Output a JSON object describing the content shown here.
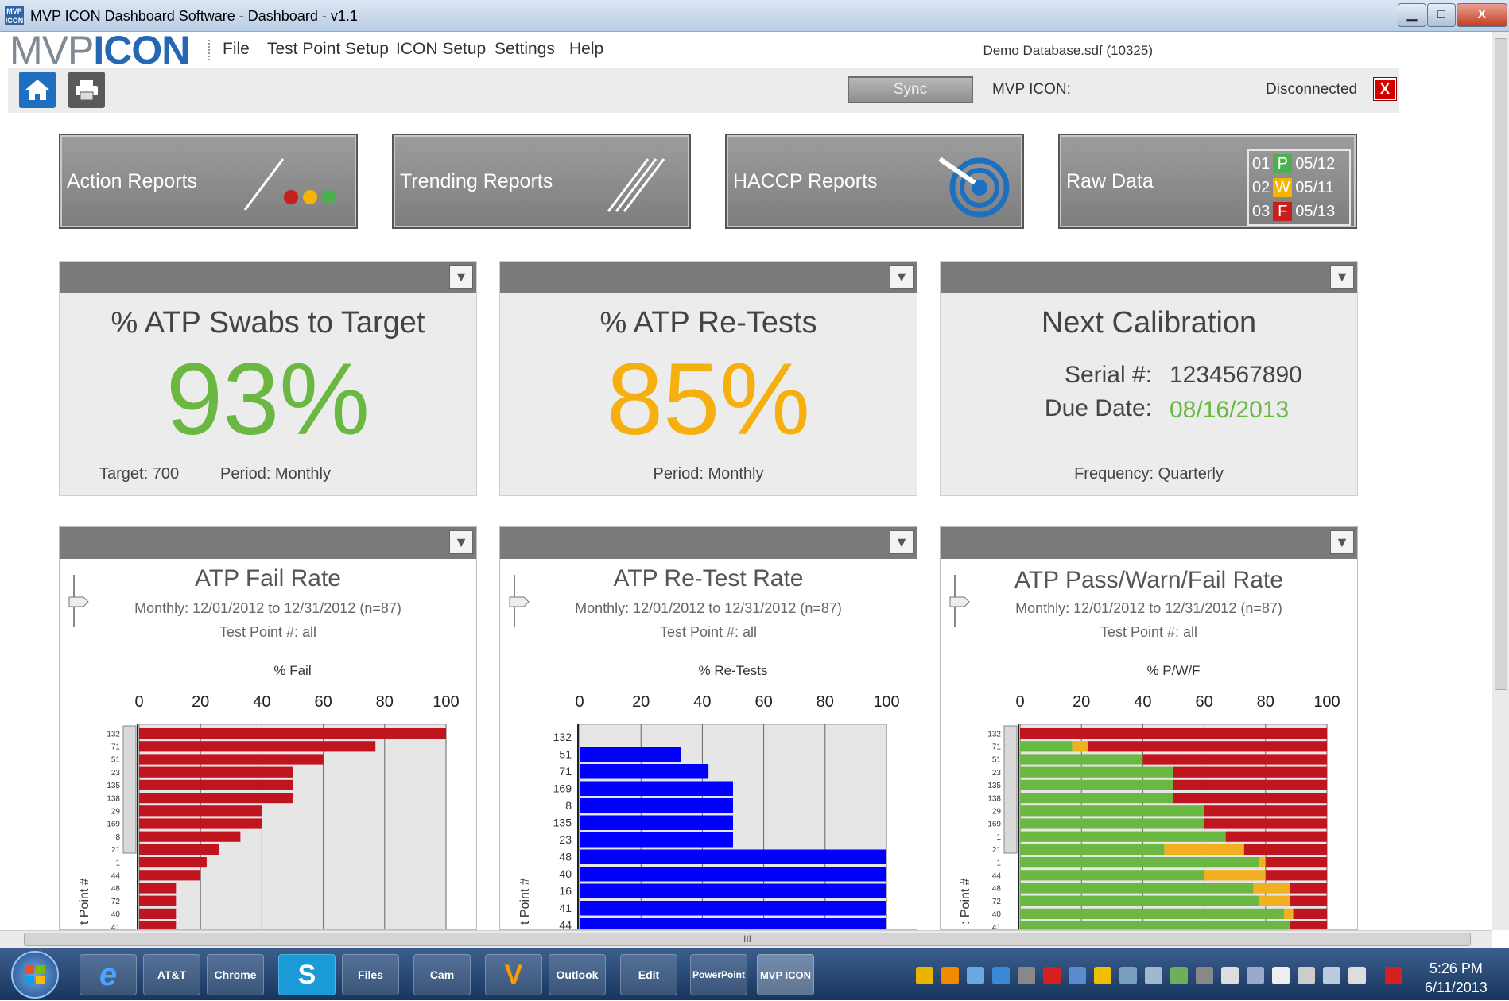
{
  "window": {
    "title": "MVP ICON Dashboard Software - Dashboard  - v1.1",
    "app_icon_text": "MVP ICON",
    "min": "▁",
    "max": "□",
    "close": "X"
  },
  "logo": {
    "part1": "MVP",
    "part2": "ICON"
  },
  "menu": [
    "File",
    "Test Point Setup",
    "ICON Setup",
    "Settings",
    "Help"
  ],
  "database": "Demo Database.sdf (10325)",
  "toolbar": {
    "sync_label": "Sync",
    "mvp_icon_label": "MVP ICON:",
    "status": "Disconnected",
    "close_glyph": "X"
  },
  "tiles": [
    {
      "label": "Action Reports"
    },
    {
      "label": "Trending Reports"
    },
    {
      "label": "HACCP Reports"
    },
    {
      "label": "Raw Data"
    }
  ],
  "raw_data_rows": [
    {
      "num": "01",
      "code": "P",
      "date": "05/12",
      "color": "#4caf50"
    },
    {
      "num": "02",
      "code": "W",
      "date": "05/11",
      "color": "#f5b400"
    },
    {
      "num": "03",
      "code": "F",
      "date": "05/13",
      "color": "#c81e1e"
    }
  ],
  "colors": {
    "green": "#6ab842",
    "orange": "#f5b010",
    "red": "#c0141e",
    "blue": "#0000ff",
    "warn": "#f0b020"
  },
  "widgets": {
    "atp_target": {
      "title": "% ATP Swabs to Target",
      "value": "93%",
      "target_label": "Target: 700",
      "period_label": "Period: Monthly"
    },
    "atp_retests": {
      "title": "% ATP Re-Tests",
      "value": "85%",
      "period_label": "Period:  Monthly"
    },
    "calibration": {
      "title": "Next Calibration",
      "serial_label": "Serial #:",
      "serial_value": "1234567890",
      "due_label": "Due Date:",
      "due_value": "08/16/2013",
      "frequency_label": "Frequency:  Quarterly"
    }
  },
  "charts": [
    {
      "title": "ATP Fail Rate",
      "subtitle": "Monthly: 12/01/2012 to 12/31/2012 (n=87)",
      "testpoint": "Test Point #: all",
      "axis_title": "% Fail",
      "ylabel": "t Point #"
    },
    {
      "title": "ATP Re-Test Rate",
      "subtitle": "Monthly: 12/01/2012 to 12/31/2012 (n=87)",
      "testpoint": "Test Point #: all",
      "axis_title": "% Re-Tests",
      "ylabel": "t Point #"
    },
    {
      "title": "ATP Pass/Warn/Fail Rate",
      "subtitle": "Monthly: 12/01/2012 to 12/31/2012 (n=87)",
      "testpoint": "Test Point #: all",
      "axis_title": "% P/W/F",
      "ylabel": ": Point #"
    }
  ],
  "chart_data": [
    {
      "type": "bar",
      "title": "ATP Fail Rate",
      "xlabel": "% Fail",
      "ylabel": "t Point #",
      "xlim": [
        0,
        100
      ],
      "ticks": [
        0,
        20,
        40,
        60,
        80,
        100
      ],
      "grid": true,
      "categories": [
        "132",
        "71",
        "51",
        "23",
        "135",
        "138",
        "29",
        "169",
        "8",
        "21",
        "1",
        "44",
        "48",
        "72",
        "40",
        "41"
      ],
      "values": [
        100,
        77,
        60,
        50,
        50,
        50,
        40,
        40,
        33,
        26,
        22,
        20,
        12,
        12,
        12,
        12
      ]
    },
    {
      "type": "bar",
      "title": "ATP Re-Test Rate",
      "xlabel": "% Re-Tests",
      "ylabel": "t Point #",
      "xlim": [
        0,
        100
      ],
      "ticks": [
        0,
        20,
        40,
        60,
        80,
        100
      ],
      "grid": true,
      "categories": [
        "132",
        "51",
        "71",
        "169",
        "8",
        "135",
        "23",
        "48",
        "40",
        "16",
        "41",
        "44"
      ],
      "values": [
        0,
        33,
        42,
        50,
        50,
        50,
        50,
        100,
        100,
        100,
        100,
        100
      ]
    },
    {
      "type": "bar",
      "stacked": true,
      "title": "ATP Pass/Warn/Fail Rate",
      "xlabel": "% P/W/F",
      "ylabel": ": Point #",
      "xlim": [
        0,
        100
      ],
      "ticks": [
        0,
        20,
        40,
        60,
        80,
        100
      ],
      "grid": true,
      "categories": [
        "132",
        "71",
        "51",
        "23",
        "135",
        "138",
        "29",
        "169",
        "1",
        "21",
        "1",
        "44",
        "48",
        "72",
        "40",
        "41"
      ],
      "series": [
        {
          "name": "Pass",
          "values": [
            0,
            17,
            40,
            50,
            50,
            50,
            60,
            60,
            67,
            47,
            78,
            60,
            76,
            78,
            86,
            88
          ]
        },
        {
          "name": "Warn",
          "values": [
            0,
            5,
            0,
            0,
            0,
            0,
            0,
            0,
            0,
            26,
            2,
            20,
            12,
            10,
            3,
            0
          ]
        },
        {
          "name": "Fail",
          "values": [
            100,
            78,
            60,
            50,
            50,
            50,
            40,
            40,
            33,
            27,
            20,
            20,
            12,
            12,
            11,
            12
          ]
        }
      ]
    }
  ],
  "scroll": {
    "h_grip": "III"
  },
  "taskbar": {
    "apps": [
      "e",
      "AT&T",
      "Chrome",
      "S",
      "Files",
      "Cam",
      "V",
      "Outlook",
      "Edit",
      "PowerPoint",
      "MVP ICON"
    ],
    "time": "5:26 PM",
    "date": "6/11/2013"
  }
}
